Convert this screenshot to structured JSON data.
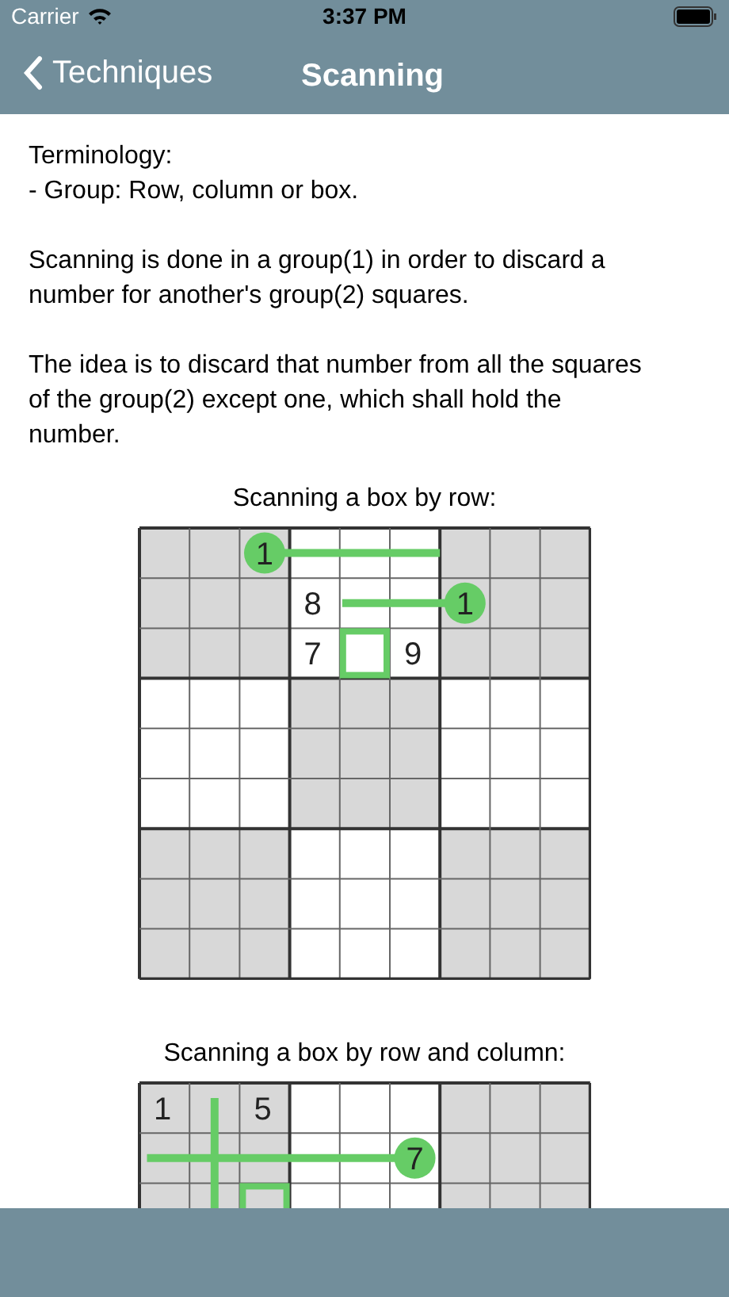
{
  "status_bar": {
    "carrier": "Carrier",
    "time": "3:37 PM"
  },
  "nav_bar": {
    "back": "Techniques",
    "title": "Scanning"
  },
  "paragraphs": [
    [
      "Terminology:",
      "- Group: Row, column or box."
    ],
    [
      "Scanning is done in a group(1) in order to discard a",
      "number for another's group(2) squares."
    ],
    [
      "The idea is to discard that number from all the squares",
      "of the group(2) except one, which shall hold the",
      "number."
    ]
  ],
  "diagrams": [
    {
      "caption": "Scanning a box by row:",
      "markers": [
        "1",
        "1"
      ],
      "rows": [
        [
          "",
          "",
          "",
          "",
          "",
          "",
          "",
          "",
          ""
        ],
        [
          "",
          "",
          "",
          "8",
          "",
          "",
          "",
          "",
          ""
        ],
        [
          "",
          "",
          "",
          "7",
          "",
          "9",
          "",
          "",
          ""
        ],
        [
          "",
          "",
          "",
          "",
          "",
          "",
          "",
          "",
          ""
        ],
        [
          "",
          "",
          "",
          "",
          "",
          "",
          "",
          "",
          ""
        ],
        [
          "",
          "",
          "",
          "",
          "",
          "",
          "",
          "",
          ""
        ],
        [
          "",
          "",
          "",
          "",
          "",
          "",
          "",
          "",
          ""
        ],
        [
          "",
          "",
          "",
          "",
          "",
          "",
          "",
          "",
          ""
        ],
        [
          "",
          "",
          "",
          "",
          "",
          "",
          "",
          "",
          ""
        ]
      ]
    },
    {
      "caption": "Scanning a box by row and column:",
      "markers": [
        "7"
      ],
      "rows": [
        [
          "1",
          "",
          "5",
          "",
          "",
          "",
          "",
          "",
          ""
        ]
      ]
    }
  ]
}
